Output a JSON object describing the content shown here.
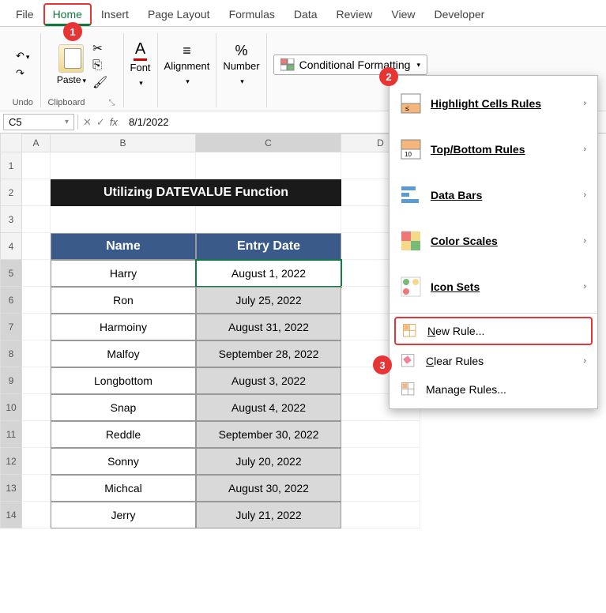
{
  "tabs": [
    "File",
    "Home",
    "Insert",
    "Page Layout",
    "Formulas",
    "Data",
    "Review",
    "View",
    "Developer"
  ],
  "active_tab": "Home",
  "ribbon": {
    "undo_label": "Undo",
    "paste_label": "Paste",
    "clipboard_label": "Clipboard",
    "font_label": "Font",
    "alignment_label": "Alignment",
    "number_label": "Number",
    "cf_button": "Conditional Formatting"
  },
  "name_box": "C5",
  "formula_value": "8/1/2022",
  "col_headers": [
    "A",
    "B",
    "C",
    "D"
  ],
  "row_headers": [
    "1",
    "2",
    "3",
    "4",
    "5",
    "6",
    "7",
    "8",
    "9",
    "10",
    "11",
    "12",
    "13",
    "14"
  ],
  "title_banner": "Utilizing DATEVALUE Function",
  "table": {
    "headers": [
      "Name",
      "Entry Date"
    ],
    "rows": [
      [
        "Harry",
        "August 1, 2022"
      ],
      [
        "Ron",
        "July 25, 2022"
      ],
      [
        "Harmoiny",
        "August 31, 2022"
      ],
      [
        "Malfoy",
        "September 28, 2022"
      ],
      [
        "Longbottom",
        "August 3, 2022"
      ],
      [
        "Snap",
        "August 4, 2022"
      ],
      [
        "Reddle",
        "September 30, 2022"
      ],
      [
        "Sonny",
        "July 20, 2022"
      ],
      [
        "Michcal",
        "August 30, 2022"
      ],
      [
        "Jerry",
        "July 21, 2022"
      ]
    ]
  },
  "cf_menu": {
    "items": [
      {
        "label": "Highlight Cells Rules",
        "arrow": true
      },
      {
        "label": "Top/Bottom Rules",
        "arrow": true
      },
      {
        "label": "Data Bars",
        "arrow": true
      },
      {
        "label": "Color Scales",
        "arrow": true
      },
      {
        "label": "Icon Sets",
        "arrow": true
      }
    ],
    "bottom": [
      {
        "label": "New Rule..."
      },
      {
        "label": "Clear Rules",
        "arrow": true
      },
      {
        "label": "Manage Rules..."
      }
    ]
  },
  "callouts": [
    "1",
    "2",
    "3"
  ]
}
